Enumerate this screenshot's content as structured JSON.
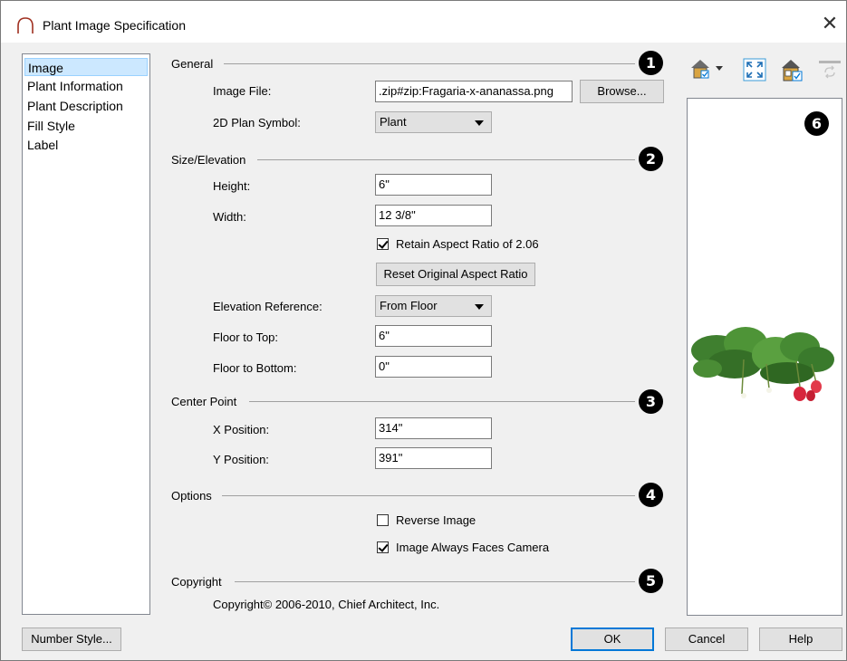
{
  "window": {
    "title": "Plant Image Specification",
    "close_glyph": "✕"
  },
  "nav": {
    "items": [
      "Image",
      "Plant Information",
      "Plant Description",
      "Fill Style",
      "Label"
    ],
    "selected": "Image"
  },
  "general": {
    "header": "General",
    "badge": "1",
    "image_file_label": "Image File:",
    "image_file_value": ".zip#zip:Fragaria-x-ananassa.png",
    "browse_label": "Browse...",
    "plan_symbol_label": "2D Plan Symbol:",
    "plan_symbol_value": "Plant"
  },
  "size": {
    "header": "Size/Elevation",
    "badge": "2",
    "height_label": "Height:",
    "height_value": "6\"",
    "width_label": "Width:",
    "width_value": "12 3/8\"",
    "retain_label": "Retain Aspect Ratio of 2.06",
    "retain_checked": true,
    "reset_label": "Reset Original Aspect Ratio",
    "elev_ref_label": "Elevation Reference:",
    "elev_ref_value": "From Floor",
    "floor_top_label": "Floor to Top:",
    "floor_top_value": "6\"",
    "floor_bottom_label": "Floor to Bottom:",
    "floor_bottom_value": "0\""
  },
  "center": {
    "header": "Center Point",
    "badge": "3",
    "x_label": "X Position:",
    "x_value": "314\"",
    "y_label": "Y Position:",
    "y_value": "391\""
  },
  "options": {
    "header": "Options",
    "badge": "4",
    "reverse_label": "Reverse Image",
    "reverse_checked": false,
    "faces_label": "Image Always Faces Camera",
    "faces_checked": true
  },
  "copyright": {
    "header": "Copyright",
    "badge": "5",
    "text": "Copyright© 2006-2010, Chief Architect, Inc."
  },
  "preview": {
    "badge": "6"
  },
  "footer": {
    "number_style": "Number Style...",
    "ok": "OK",
    "cancel": "Cancel",
    "help": "Help"
  },
  "colors": {
    "accent": "#0078d7",
    "selection": "#cce8ff"
  }
}
